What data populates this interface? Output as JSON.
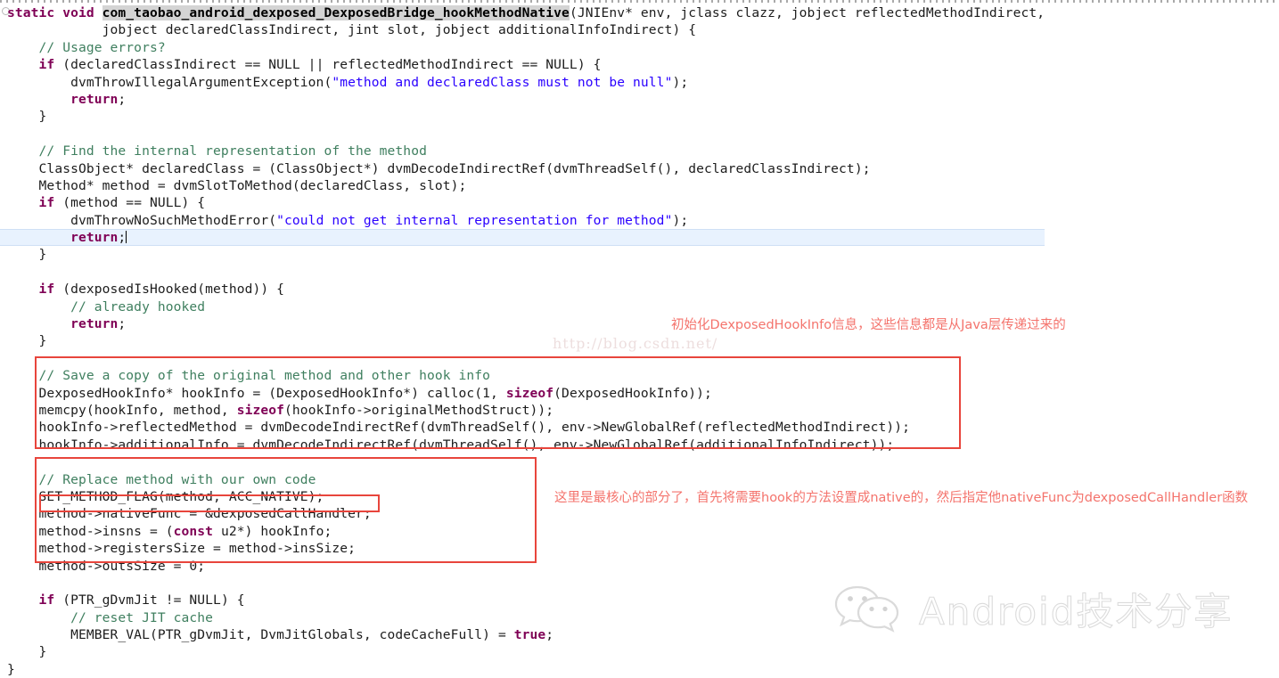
{
  "editor": {
    "language": "c",
    "theme_colors": {
      "background": "#ffffff",
      "keyword": "#7f0055",
      "string": "#2a00ff",
      "comment": "#3f7f5f",
      "plain": "#1c1c1c",
      "current_line_highlight": "#e8f2fe",
      "occurrence_highlight": "#d4d4d4",
      "annotation_red": "#e8453c",
      "annotation_text_red": "#f4736c"
    },
    "code_lines": [
      [
        {
          "t": "kw",
          "s": "static void "
        },
        {
          "t": "fn",
          "s": "com_taobao_android_dexposed_DexposedBridge_hookMethodNative"
        },
        {
          "t": "p",
          "s": "(JNIEnv* env, jclass clazz, jobject reflectedMethodIndirect,"
        }
      ],
      [
        {
          "t": "p",
          "s": "            jobject declaredClassIndirect, jint slot, jobject additionalInfoIndirect) {"
        }
      ],
      [
        {
          "t": "cmt",
          "s": "    // Usage errors?"
        }
      ],
      [
        {
          "t": "kw",
          "s": "    if"
        },
        {
          "t": "p",
          "s": " (declaredClassIndirect == NULL || reflectedMethodIndirect == NULL) {"
        }
      ],
      [
        {
          "t": "p",
          "s": "        dvmThrowIllegalArgumentException("
        },
        {
          "t": "str",
          "s": "\"method and declaredClass must not be null\""
        },
        {
          "t": "p",
          "s": ");"
        }
      ],
      [
        {
          "t": "kw",
          "s": "        return"
        },
        {
          "t": "p",
          "s": ";"
        }
      ],
      [
        {
          "t": "p",
          "s": "    }"
        }
      ],
      [
        {
          "t": "p",
          "s": ""
        }
      ],
      [
        {
          "t": "cmt",
          "s": "    // Find the internal representation of the method"
        }
      ],
      [
        {
          "t": "p",
          "s": "    ClassObject* declaredClass = (ClassObject*) dvmDecodeIndirectRef(dvmThreadSelf(), declaredClassIndirect);"
        }
      ],
      [
        {
          "t": "p",
          "s": "    Method* method = dvmSlotToMethod(declaredClass, slot);"
        }
      ],
      [
        {
          "t": "kw",
          "s": "    if"
        },
        {
          "t": "p",
          "s": " (method == NULL) {"
        }
      ],
      [
        {
          "t": "p",
          "s": "        dvmThrowNoSuchMethodError("
        },
        {
          "t": "str",
          "s": "\"could not get internal representation for method\""
        },
        {
          "t": "p",
          "s": ");"
        }
      ],
      [
        {
          "t": "kw",
          "s": "        return"
        },
        {
          "t": "p",
          "s": ";"
        },
        {
          "t": "caret",
          "s": ""
        }
      ],
      [
        {
          "t": "p",
          "s": "    }"
        }
      ],
      [
        {
          "t": "p",
          "s": ""
        }
      ],
      [
        {
          "t": "kw",
          "s": "    if"
        },
        {
          "t": "p",
          "s": " (dexposedIsHooked(method)) {"
        }
      ],
      [
        {
          "t": "cmt",
          "s": "        // already hooked"
        }
      ],
      [
        {
          "t": "kw",
          "s": "        return"
        },
        {
          "t": "p",
          "s": ";"
        }
      ],
      [
        {
          "t": "p",
          "s": "    }"
        }
      ],
      [
        {
          "t": "p",
          "s": ""
        }
      ],
      [
        {
          "t": "cmt",
          "s": "    // Save a copy of the original method and other hook info"
        }
      ],
      [
        {
          "t": "p",
          "s": "    DexposedHookInfo* hookInfo = (DexposedHookInfo*) calloc(1, "
        },
        {
          "t": "kw",
          "s": "sizeof"
        },
        {
          "t": "p",
          "s": "(DexposedHookInfo));"
        }
      ],
      [
        {
          "t": "p",
          "s": "    memcpy(hookInfo, method, "
        },
        {
          "t": "kw",
          "s": "sizeof"
        },
        {
          "t": "p",
          "s": "(hookInfo->originalMethodStruct));"
        }
      ],
      [
        {
          "t": "p",
          "s": "    hookInfo->reflectedMethod = dvmDecodeIndirectRef(dvmThreadSelf(), env->NewGlobalRef(reflectedMethodIndirect));"
        }
      ],
      [
        {
          "t": "p",
          "s": "    hookInfo->additionalInfo = dvmDecodeIndirectRef(dvmThreadSelf(), env->NewGlobalRef(additionalInfoIndirect));"
        }
      ],
      [
        {
          "t": "p",
          "s": ""
        }
      ],
      [
        {
          "t": "cmt",
          "s": "    // Replace method with our own code"
        }
      ],
      [
        {
          "t": "p",
          "s": "    SET_METHOD_FLAG(method, ACC_NATIVE);"
        }
      ],
      [
        {
          "t": "p",
          "s": "    method->nativeFunc = &dexposedCallHandler;"
        }
      ],
      [
        {
          "t": "p",
          "s": "    method->insns = ("
        },
        {
          "t": "kw",
          "s": "const"
        },
        {
          "t": "p",
          "s": " u2*) hookInfo;"
        }
      ],
      [
        {
          "t": "p",
          "s": "    method->registersSize = method->insSize;"
        }
      ],
      [
        {
          "t": "p",
          "s": "    method->outsSize = 0;"
        }
      ],
      [
        {
          "t": "p",
          "s": ""
        }
      ],
      [
        {
          "t": "kw",
          "s": "    if"
        },
        {
          "t": "p",
          "s": " (PTR_gDvmJit != NULL) {"
        }
      ],
      [
        {
          "t": "cmt",
          "s": "        // reset JIT cache"
        }
      ],
      [
        {
          "t": "p",
          "s": "        MEMBER_VAL(PTR_gDvmJit, DvmJitGlobals, codeCacheFull) = "
        },
        {
          "t": "kw",
          "s": "true"
        },
        {
          "t": "p",
          "s": ";"
        }
      ],
      [
        {
          "t": "p",
          "s": "    }"
        }
      ],
      [
        {
          "t": "p",
          "s": "}"
        }
      ]
    ],
    "highlighted_line_index": 13
  },
  "annotations": {
    "note_hookinfo": "初始化DexposedHookInfo信息，这些信息都是从Java层传递过来的",
    "note_replace": "这里是最核心的部分了，首先将需要hook的方法设置成native的，然后指定他nativeFunc为dexposedCallHandler函数",
    "boxes": [
      {
        "name": "hookinfo-box",
        "label": "Save a copy of the original method and other hook info"
      },
      {
        "name": "replace-box",
        "label": "Replace method with our own code"
      },
      {
        "name": "nativefunc-box",
        "label": "method->nativeFunc = &dexposedCallHandler;"
      }
    ]
  },
  "watermarks": {
    "url": "http://blog.csdn.net/",
    "logo_text": "Android技术分享",
    "logo_icon": "wechat-bubbles-icon"
  }
}
